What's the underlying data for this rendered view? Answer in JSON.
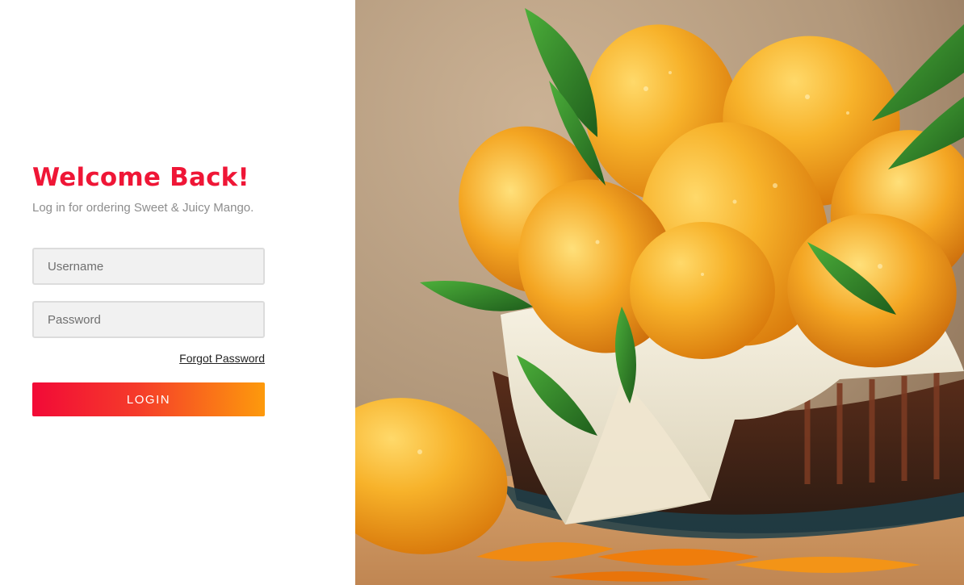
{
  "login": {
    "title": "Welcome Back!",
    "subtitle": "Log in for ordering Sweet & Juicy Mango.",
    "username_placeholder": "Username",
    "password_placeholder": "Password",
    "forgot_password_label": "Forgot Password",
    "login_button_label": "LOGIN"
  },
  "hero": {
    "image_alt": "Basket of mangoes",
    "colors": {
      "brand_red": "#ef1636",
      "gradient_start": "#f20a37",
      "gradient_end": "#fd9a0c"
    }
  }
}
